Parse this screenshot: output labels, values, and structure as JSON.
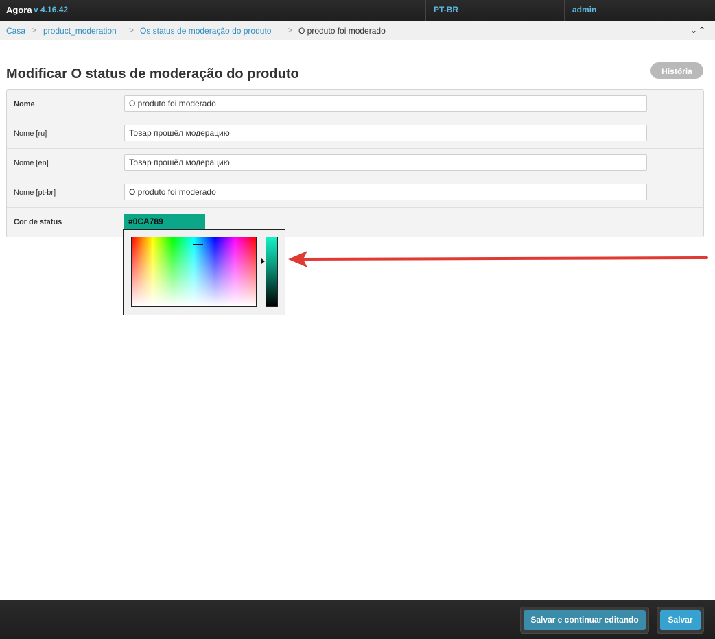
{
  "topbar": {
    "brand": "Agora",
    "version": "v 4.16.42",
    "language": "PT-BR",
    "user": "admin"
  },
  "breadcrumbs": {
    "items": [
      "Casa",
      "product_moderation",
      "Os status de moderação do produto"
    ],
    "current": "O produto foi moderado",
    "separator": ">",
    "collapse_icons": "⌄⌃"
  },
  "page": {
    "title": "Modificar O status de moderação do produto",
    "history_label": "História"
  },
  "form": {
    "rows": [
      {
        "label": "Nome",
        "value": "O produto foi moderado"
      },
      {
        "label": "Nome [ru]",
        "value": "Товар прошёл модерацию"
      },
      {
        "label": "Nome [en]",
        "value": "Товар прошёл модерацию"
      },
      {
        "label": "Nome [pt-br]",
        "value": "O produto foi moderado"
      }
    ],
    "color": {
      "label": "Cor de status",
      "value": "#0CA789"
    }
  },
  "colors": {
    "accent": "#2f8fc0",
    "status_color": "#0CA789",
    "annotation": "#e03a34"
  },
  "footer": {
    "save_continue_label": "Salvar e continuar editando",
    "save_label": "Salvar"
  }
}
